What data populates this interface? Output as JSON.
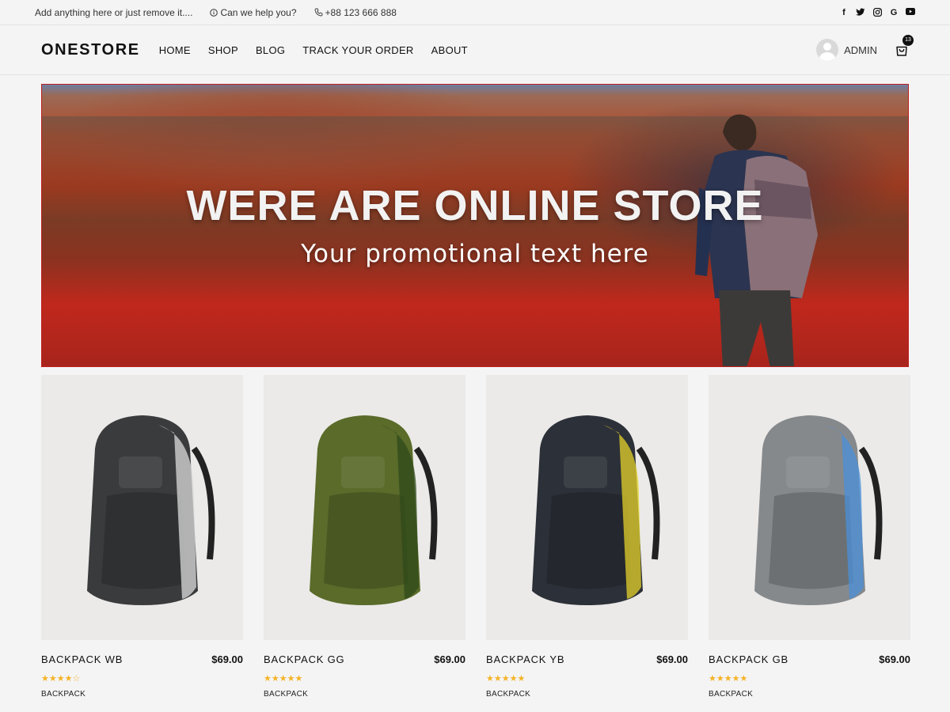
{
  "topbar": {
    "message": "Add anything here or just remove it....",
    "help": "Can we help you?",
    "phone": "+88 123 666 888",
    "social_icons": [
      "facebook-icon",
      "twitter-icon",
      "instagram-icon",
      "google-icon",
      "youtube-icon"
    ]
  },
  "header": {
    "logo": "ONESTORE",
    "nav": [
      "HOME",
      "SHOP",
      "BLOG",
      "TRACK YOUR ORDER",
      "ABOUT"
    ],
    "user": "ADMIN",
    "cart_count": "13"
  },
  "hero": {
    "title": "WERE ARE ONLINE STORE",
    "subtitle": "Your promotional text here"
  },
  "products": [
    {
      "name": "BACKPACK WB",
      "price": "$69.00",
      "rating": 4,
      "category": "BACKPACK",
      "color": "#3a3b3d",
      "accent": "#dcdcdc"
    },
    {
      "name": "BACKPACK GG",
      "price": "$69.00",
      "rating": 5,
      "category": "BACKPACK",
      "color": "#5a6b2a",
      "accent": "#2f4a1a"
    },
    {
      "name": "BACKPACK YB",
      "price": "$69.00",
      "rating": 5,
      "category": "BACKPACK",
      "color": "#2c3038",
      "accent": "#e4d22a"
    },
    {
      "name": "BACKPACK GB",
      "price": "$69.00",
      "rating": 5,
      "category": "BACKPACK",
      "color": "#86898c",
      "accent": "#4a90d9"
    }
  ],
  "colors": {
    "accent_star": "#f5b323",
    "background": "#f4f4f5"
  }
}
